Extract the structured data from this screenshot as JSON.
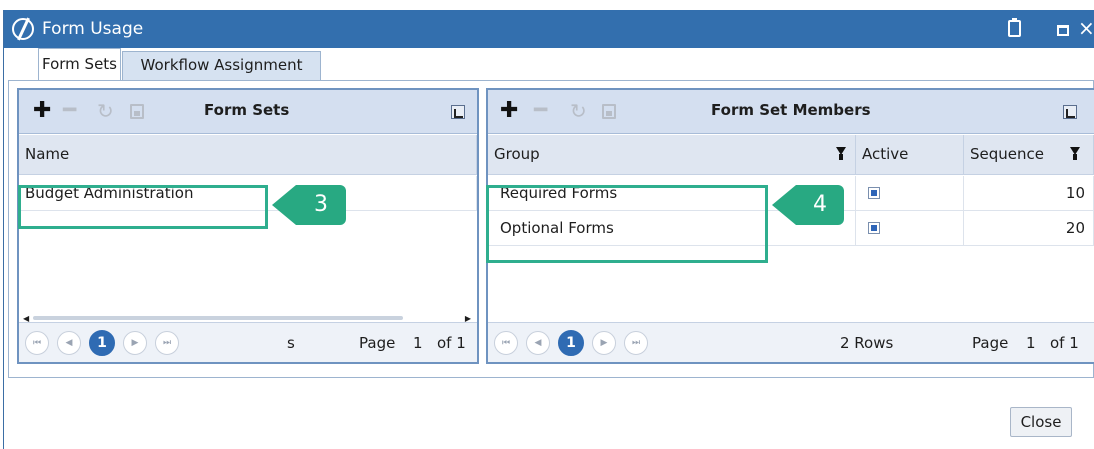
{
  "window": {
    "title": "Form Usage"
  },
  "tabs": [
    {
      "label": "Form Sets"
    },
    {
      "label": "Workflow Assignment"
    }
  ],
  "left_panel": {
    "title": "Form Sets",
    "column": "Name",
    "rows": [
      "Budget Administration"
    ],
    "pager": {
      "current_page": "1",
      "rows_text": "s",
      "page_label": "Page",
      "page_value": "1",
      "of_label": "of 1"
    }
  },
  "right_panel": {
    "title": "Form Set Members",
    "columns": [
      "Group",
      "Active",
      "Sequence"
    ],
    "rows": [
      {
        "group": "Required Forms",
        "active": true,
        "sequence": "10"
      },
      {
        "group": "Optional Forms",
        "active": true,
        "sequence": "20"
      }
    ],
    "pager": {
      "current_page": "1",
      "rows_text": "2 Rows",
      "page_label": "Page",
      "page_value": "1",
      "of_label": "of 1"
    }
  },
  "callouts": [
    "3",
    "4"
  ],
  "footer": {
    "close_label": "Close"
  },
  "colors": {
    "titlebar": "#336fae",
    "callout": "#28a982",
    "pager_current": "#2f6bb3"
  }
}
